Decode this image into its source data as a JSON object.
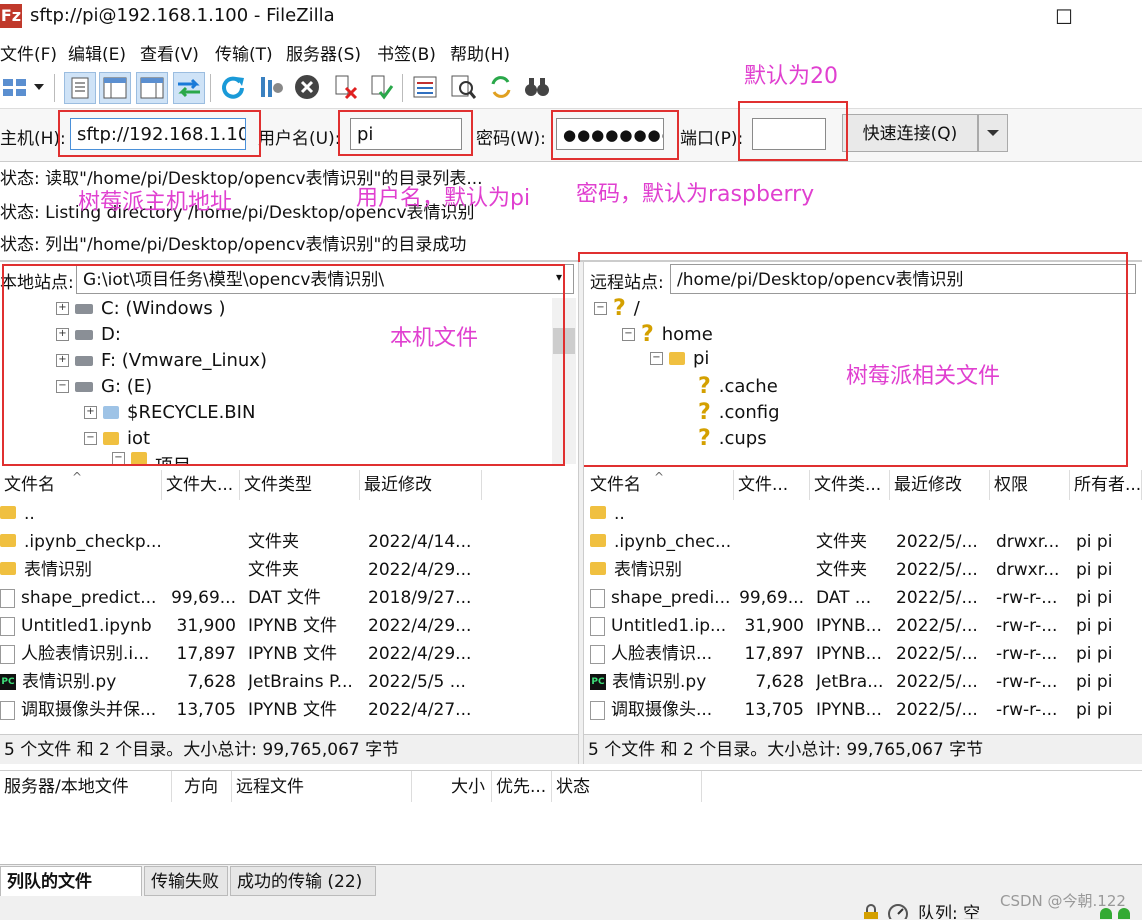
{
  "window": {
    "title": "sftp://pi@192.168.1.100 - FileZilla",
    "app_icon": "Fz",
    "maximize_glyph": "☐"
  },
  "menu": [
    "文件(F)",
    "编辑(E)",
    "查看(V)",
    "传输(T)",
    "服务器(S)",
    "书签(B)",
    "帮助(H)"
  ],
  "quickconnect": {
    "host_label": "主机(H):",
    "host_value": "sftp://192.168.1.10",
    "user_label": "用户名(U):",
    "user_value": "pi",
    "pass_label": "密码(W):",
    "pass_value": "●●●●●●●●",
    "port_label": "端口(P):",
    "port_value": "",
    "connect_label": "快速连接(Q)"
  },
  "annotations": {
    "port_note": "默认为20",
    "host_note": "树莓派主机地址",
    "user_note": "用户名，默认为pi",
    "pass_note": "密码，默认为raspberry",
    "local_note": "本机文件",
    "remote_note": "树莓派相关文件"
  },
  "log": [
    "状态:  读取\"/home/pi/Desktop/opencv表情识别\"的目录列表...",
    "状态:  Listing directory /home/pi/Desktop/opencv表情识别",
    "状态:  列出\"/home/pi/Desktop/opencv表情识别\"的目录成功"
  ],
  "local": {
    "site_label": "本地站点:",
    "path": "G:\\iot\\项目任务\\模型\\opencv表情识别\\",
    "tree": [
      {
        "label": "C: (Windows )",
        "type": "drive",
        "expander": "+"
      },
      {
        "label": "D:",
        "type": "drive",
        "expander": "+"
      },
      {
        "label": "F: (Vmware_Linux)",
        "type": "drive",
        "expander": "+"
      },
      {
        "label": "G: (E)",
        "type": "drive",
        "expander": "−"
      },
      {
        "label": "$RECYCLE.BIN",
        "type": "recycle",
        "expander": "+"
      },
      {
        "label": "iot",
        "type": "folder",
        "expander": "−"
      },
      {
        "label": "项目",
        "type": "folder",
        "expander": "−"
      }
    ],
    "columns": [
      "文件名",
      "文件大...",
      "文件类型",
      "最近修改"
    ],
    "files": [
      {
        "name": "..",
        "icon": "folder",
        "size": "",
        "type": "",
        "modified": ""
      },
      {
        "name": ".ipynb_checkp...",
        "icon": "folder",
        "size": "",
        "type": "文件夹",
        "modified": "2022/4/14..."
      },
      {
        "name": "表情识别",
        "icon": "folder",
        "size": "",
        "type": "文件夹",
        "modified": "2022/4/29..."
      },
      {
        "name": "shape_predict...",
        "icon": "file",
        "size": "99,69...",
        "type": "DAT 文件",
        "modified": "2018/9/27..."
      },
      {
        "name": "Untitled1.ipynb",
        "icon": "file",
        "size": "31,900",
        "type": "IPYNB 文件",
        "modified": "2022/4/29..."
      },
      {
        "name": "人脸表情识别.i...",
        "icon": "file",
        "size": "17,897",
        "type": "IPYNB 文件",
        "modified": "2022/4/29..."
      },
      {
        "name": "表情识别.py",
        "icon": "py",
        "size": "7,628",
        "type": "JetBrains P...",
        "modified": "2022/5/5 ..."
      },
      {
        "name": "调取摄像头并保...",
        "icon": "file",
        "size": "13,705",
        "type": "IPYNB 文件",
        "modified": "2022/4/27..."
      }
    ],
    "summary": "5 个文件 和 2 个目录。大小总计: 99,765,067 字节"
  },
  "remote": {
    "site_label": "远程站点:",
    "path": "/home/pi/Desktop/opencv表情识别",
    "tree": [
      {
        "label": "/",
        "type": "q",
        "expander": "−"
      },
      {
        "label": "home",
        "type": "q",
        "expander": "−"
      },
      {
        "label": "pi",
        "type": "folder",
        "expander": "−"
      },
      {
        "label": ".cache",
        "type": "q",
        "expander": ""
      },
      {
        "label": ".config",
        "type": "q",
        "expander": ""
      },
      {
        "label": ".cups",
        "type": "q",
        "expander": ""
      }
    ],
    "columns": [
      "文件名",
      "文件...",
      "文件类...",
      "最近修改",
      "权限",
      "所有者..."
    ],
    "files": [
      {
        "name": "..",
        "icon": "folder",
        "size": "",
        "type": "",
        "modified": "",
        "perm": "",
        "owner": ""
      },
      {
        "name": ".ipynb_chec...",
        "icon": "folder",
        "size": "",
        "type": "文件夹",
        "modified": "2022/5/...",
        "perm": "drwxr...",
        "owner": "pi pi"
      },
      {
        "name": "表情识别",
        "icon": "folder",
        "size": "",
        "type": "文件夹",
        "modified": "2022/5/...",
        "perm": "drwxr...",
        "owner": "pi pi"
      },
      {
        "name": "shape_predi...",
        "icon": "file",
        "size": "99,69...",
        "type": "DAT ...",
        "modified": "2022/5/...",
        "perm": "-rw-r-...",
        "owner": "pi pi"
      },
      {
        "name": "Untitled1.ip...",
        "icon": "file",
        "size": "31,900",
        "type": "IPYNB...",
        "modified": "2022/5/...",
        "perm": "-rw-r-...",
        "owner": "pi pi"
      },
      {
        "name": "人脸表情识...",
        "icon": "file",
        "size": "17,897",
        "type": "IPYNB...",
        "modified": "2022/5/...",
        "perm": "-rw-r-...",
        "owner": "pi pi"
      },
      {
        "name": "表情识别.py",
        "icon": "py",
        "size": "7,628",
        "type": "JetBra...",
        "modified": "2022/5/...",
        "perm": "-rw-r-...",
        "owner": "pi pi"
      },
      {
        "name": "调取摄像头...",
        "icon": "file",
        "size": "13,705",
        "type": "IPYNB...",
        "modified": "2022/5/...",
        "perm": "-rw-r-...",
        "owner": "pi pi"
      }
    ],
    "summary": "5 个文件 和 2 个目录。大小总计: 99,765,067 字节"
  },
  "transfer_columns": [
    "服务器/本地文件",
    "方向",
    "远程文件",
    "大小",
    "优先...",
    "状态"
  ],
  "queue_tabs": [
    "列队的文件",
    "传输失败",
    "成功的传输 (22)"
  ],
  "bottom_status": {
    "queue": "队列: 空"
  },
  "watermark": "CSDN @今朝.122",
  "colors": {
    "annotation": "#e040d0",
    "highlight_box": "#e03030"
  }
}
